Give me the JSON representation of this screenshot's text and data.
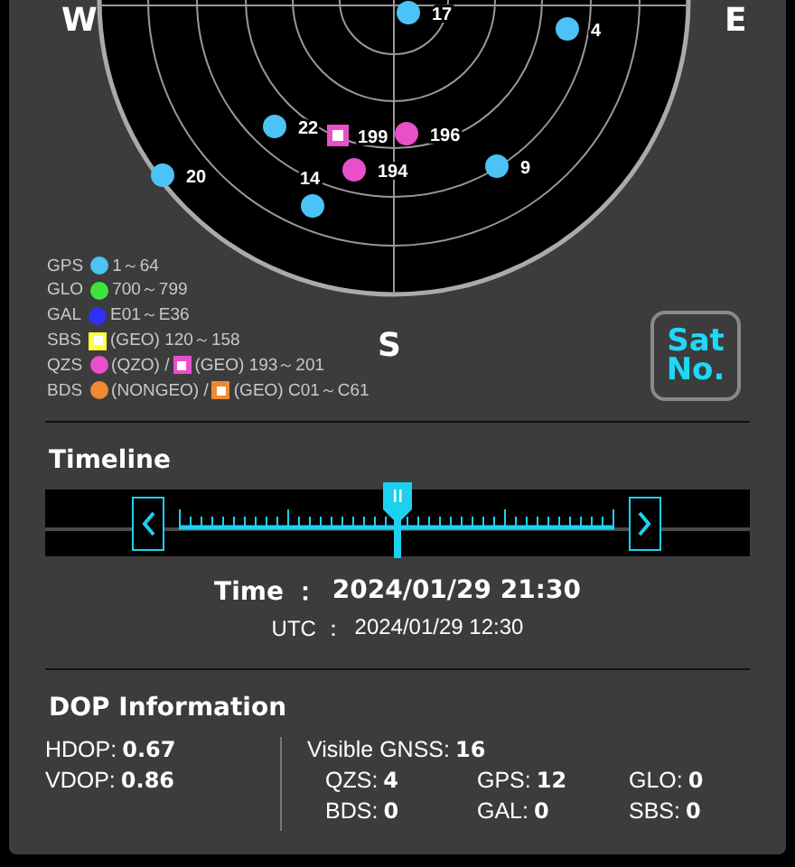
{
  "compass": {
    "west": "W",
    "east": "E",
    "south": "S"
  },
  "satellites": [
    {
      "label": "17",
      "kind": "circle",
      "color": "#4cc3f7"
    },
    {
      "label": "4",
      "kind": "circle",
      "color": "#4cc3f7"
    },
    {
      "label": "22",
      "kind": "circle",
      "color": "#4cc3f7"
    },
    {
      "label": "199",
      "kind": "square",
      "color": "#e84fc9"
    },
    {
      "label": "196",
      "kind": "circle",
      "color": "#e84fc9"
    },
    {
      "label": "20",
      "kind": "circle",
      "color": "#4cc3f7"
    },
    {
      "label": "14",
      "kind": "circle",
      "color": "#4cc3f7"
    },
    {
      "label": "194",
      "kind": "circle",
      "color": "#e84fc9"
    },
    {
      "label": "9",
      "kind": "circle",
      "color": "#4cc3f7"
    }
  ],
  "legend": [
    {
      "name": "GPS",
      "marks": [
        {
          "kind": "circle",
          "color": "#4cc3f7",
          "text": "1～64"
        }
      ]
    },
    {
      "name": "GLO",
      "marks": [
        {
          "kind": "circle",
          "color": "#3ee43e",
          "text": "700～799"
        }
      ]
    },
    {
      "name": "GAL",
      "marks": [
        {
          "kind": "circle",
          "color": "#3030f0",
          "text": "E01～E36"
        }
      ]
    },
    {
      "name": "SBS",
      "marks": [
        {
          "kind": "square",
          "color": "#ffff44",
          "text": "(GEO) 120～158"
        }
      ]
    },
    {
      "name": "QZS",
      "marks": [
        {
          "kind": "circle",
          "color": "#e84fc9",
          "text": "(QZO) /"
        },
        {
          "kind": "square",
          "color": "#e84fc9",
          "text": "(GEO) 193～201"
        }
      ]
    },
    {
      "name": "BDS",
      "marks": [
        {
          "kind": "circle",
          "color": "#f08a30",
          "text": "(NONGEO) /"
        },
        {
          "kind": "square",
          "color": "#f08a30",
          "text": "(GEO) C01～C61"
        }
      ]
    }
  ],
  "sat_no_button": {
    "lines": [
      "Sat",
      "No."
    ]
  },
  "timeline": {
    "title": "Timeline",
    "slider": {
      "level": 0.5
    },
    "time": {
      "label": "Time ：",
      "value": "2024/01/29 21:30"
    },
    "utc": {
      "label": "UTC ：",
      "value": "2024/01/29 12:30"
    }
  },
  "dop": {
    "title": "DOP Information",
    "values": [
      {
        "label": "HDOP:",
        "value": "0.67"
      },
      {
        "label": "VDOP:",
        "value": "0.86"
      }
    ],
    "visible": {
      "label": "Visible GNSS:",
      "value": "16"
    },
    "counts": [
      {
        "label": "QZS:",
        "value": "4"
      },
      {
        "label": "GPS:",
        "value": "12"
      },
      {
        "label": "GLO:",
        "value": "0"
      },
      {
        "label": "BDS:",
        "value": "0"
      },
      {
        "label": "GAL:",
        "value": "0"
      },
      {
        "label": "SBS:",
        "value": "0"
      }
    ]
  }
}
